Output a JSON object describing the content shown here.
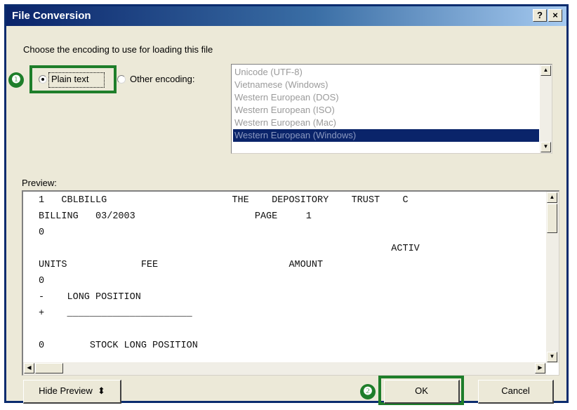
{
  "window": {
    "title": "File Conversion",
    "help_label": "?",
    "close_label": "×"
  },
  "prompt": "Choose the encoding to use for loading this file",
  "options": {
    "plain_text": "Plain text",
    "other_encoding": "Other encoding:",
    "selected": "plain_text"
  },
  "encodings": [
    "Unicode (UTF-8)",
    "Vietnamese (Windows)",
    "Western European (DOS)",
    "Western European (ISO)",
    "Western European (Mac)",
    "Western European (Windows)"
  ],
  "encoding_selected": "Western European (Windows)",
  "preview": {
    "label": "Preview:",
    "lines": [
      "1   CBLBILLG                      THE    DEPOSITORY    TRUST    C",
      "BILLING   03/2003                     PAGE     1",
      "0",
      "                                                              ACTIV",
      "UNITS             FEE                       AMOUNT",
      "0",
      "-    LONG POSITION",
      "+    ______________________",
      "",
      "0        STOCK LONG POSITION"
    ]
  },
  "buttons": {
    "hide_preview": "Hide Preview",
    "ok": "OK",
    "cancel": "Cancel"
  },
  "callouts": {
    "one": "❶",
    "two": "❷"
  },
  "colors": {
    "title_bar": "#0a246a",
    "dialog_bg": "#ece9d8",
    "highlight_green": "#1e7e2a",
    "selection": "#0a246a"
  }
}
